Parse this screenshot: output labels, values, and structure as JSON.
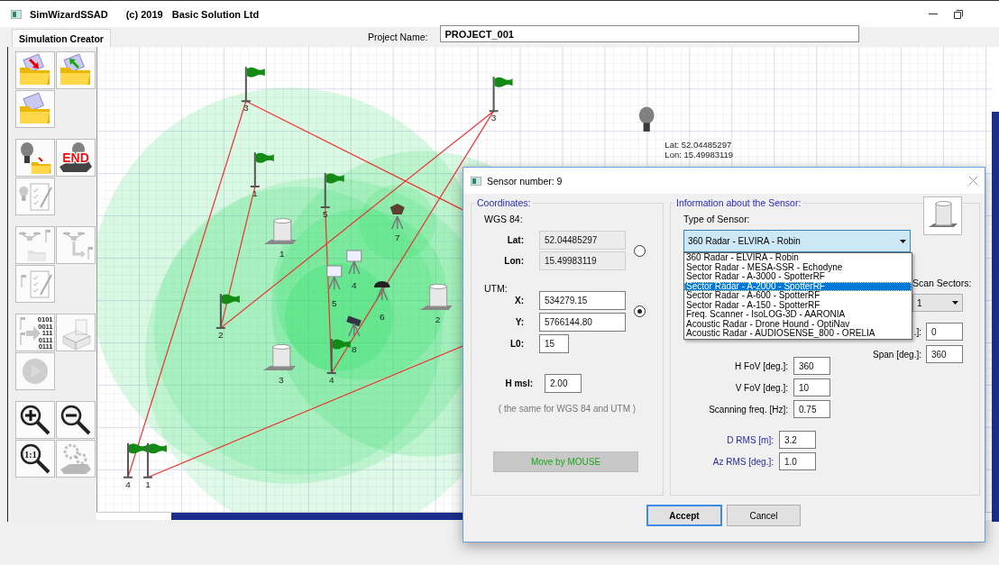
{
  "window": {
    "title": "SimWizardSSAD",
    "copyright": "(c) 2019",
    "company": "Basic Solution Ltd"
  },
  "tabs": [
    {
      "label": "Simulation Creator",
      "selected": true
    }
  ],
  "project": {
    "label": "Project Name:",
    "value": "PROJECT_001"
  },
  "toolbar": [
    [
      {
        "kind": "import",
        "disabled": false
      },
      {
        "kind": "export",
        "disabled": false
      },
      {
        "kind": "open",
        "disabled": false
      }
    ],
    [
      {
        "kind": "sensor-save",
        "disabled": false
      },
      {
        "kind": "sensor-end",
        "text": "END",
        "disabled": false
      },
      {
        "kind": "sensor-edit",
        "disabled": true
      }
    ],
    [
      {
        "kind": "route-save",
        "disabled": true
      },
      {
        "kind": "route-link",
        "disabled": true
      },
      {
        "kind": "route-edit",
        "disabled": true
      }
    ],
    [
      {
        "kind": "export-binary",
        "lines": [
          "0101",
          "0011",
          "111",
          "0111",
          "0111"
        ],
        "disabled": true
      },
      {
        "kind": "build",
        "disabled": true
      },
      {
        "kind": "play",
        "disabled": true
      }
    ],
    [
      {
        "kind": "zoom-in",
        "disabled": false
      },
      {
        "kind": "zoom-out",
        "disabled": false
      },
      {
        "kind": "zoom-reset",
        "text": "1:1",
        "disabled": false
      },
      {
        "kind": "terrain",
        "disabled": true
      }
    ]
  ],
  "map": {
    "flags": [
      {
        "label": "3"
      },
      {
        "label": "1"
      },
      {
        "label": "5"
      },
      {
        "label": "2"
      },
      {
        "label": "4"
      },
      {
        "label": "4"
      },
      {
        "label": "1"
      },
      {
        "label": "3"
      }
    ],
    "sensors": [
      {
        "kind": "radar",
        "label": "1"
      },
      {
        "kind": "radar",
        "label": "3"
      },
      {
        "kind": "radar",
        "label": "2"
      },
      {
        "kind": "speaker",
        "label": "7"
      },
      {
        "kind": "box",
        "label": "4"
      },
      {
        "kind": "box",
        "label": "5"
      },
      {
        "kind": "dome",
        "label": "6"
      },
      {
        "kind": "camera",
        "label": "8"
      }
    ],
    "dish": {
      "lat": "Lat:  52.04485297",
      "lon": "Lon: 15.49983119"
    }
  },
  "dialog": {
    "title": "Sensor number: 9",
    "coordinates": {
      "legend": "Coordinates:",
      "wgs_label": "WGS 84:",
      "wgs_selected": false,
      "lat": {
        "label": "Lat:",
        "value": "52.04485297",
        "disabled": true
      },
      "lon": {
        "label": "Lon:",
        "value": "15.49983119",
        "disabled": true
      },
      "utm_label": "UTM:",
      "utm_selected": true,
      "x": {
        "label": "X:",
        "value": "534279.15",
        "disabled": false
      },
      "y": {
        "label": "Y:",
        "value": "5766144.80",
        "disabled": false
      },
      "l0": {
        "label": "L0:",
        "value": "15",
        "disabled": false
      },
      "hmsl": {
        "label": "H msl:",
        "value": "2.00",
        "disabled": false
      },
      "note": "( the same for WGS 84 and UTM )",
      "move_button": "Move by MOUSE"
    },
    "sensor": {
      "legend": "Information about the Sensor:",
      "type_label": "Type of Sensor:",
      "type_value": "360 Radar - ELVIRA - Robin",
      "options": [
        {
          "label": "360 Radar - ELVIRA - Robin",
          "selected": false
        },
        {
          "label": "Sector Radar - MESA-SSR - Echodyne",
          "selected": false
        },
        {
          "label": "Sector Radar - A-3000 - SpotterRF",
          "selected": false
        },
        {
          "label": "Sector Radar - A-2000 - SpotterRF",
          "selected": true
        },
        {
          "label": "Sector Radar - A-600 - SpotterRF",
          "selected": false
        },
        {
          "label": "Sector Radar - A-150 - SpotterRF",
          "selected": false
        },
        {
          "label": "Freq. Scanner - IsoLOG-3D - AARONIA",
          "selected": false
        },
        {
          "label": "Acoustic Radar - Drone Hound - OptiNav",
          "selected": false
        },
        {
          "label": "Acoustic Radar - AUDIOSENSE_800 - ORELIA",
          "selected": false
        }
      ],
      "scan_sectors": {
        "label": "Scan Sectors:",
        "value": "1"
      },
      "start": {
        "label": ".]:",
        "value": "0"
      },
      "span": {
        "label": "Span [deg.]:",
        "value": "360"
      },
      "fields": [
        {
          "label": "H FoV [deg.]:",
          "value": "360",
          "kind": "plain"
        },
        {
          "label": "V FoV [deg.]:",
          "value": "10",
          "kind": "plain"
        },
        {
          "label": "Scanning freq. [Hz]:",
          "value": "0.75",
          "kind": "plain"
        },
        {
          "label": "D RMS [m]:",
          "value": "3.2",
          "kind": "accuracy"
        },
        {
          "label": "Az RMS [deg.]:",
          "value": "1.0",
          "kind": "accuracy"
        }
      ]
    },
    "buttons": [
      {
        "label": "Accept",
        "default": true
      },
      {
        "label": "Cancel",
        "default": false
      }
    ]
  }
}
